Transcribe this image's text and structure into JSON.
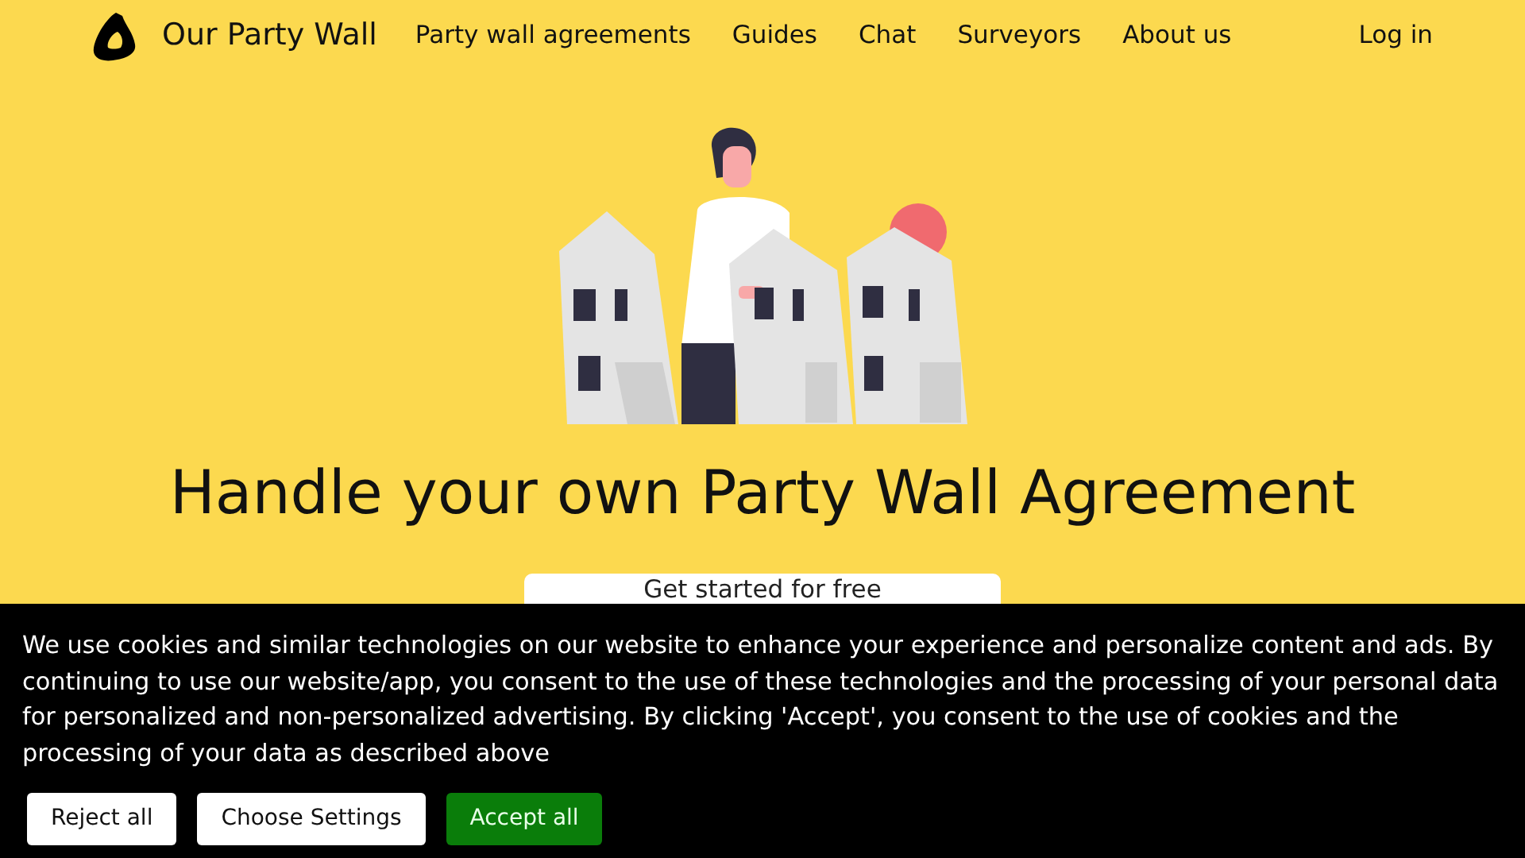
{
  "header": {
    "brand": "Our Party Wall",
    "nav": [
      "Party wall agreements",
      "Guides",
      "Chat",
      "Surveyors",
      "About us"
    ],
    "login": "Log in"
  },
  "hero": {
    "title": "Handle your own Party Wall Agreement",
    "cta": "Get started for free"
  },
  "cookie_banner": {
    "text": "We use cookies and similar technologies on our website to enhance your experience and personalize content and ads. By continuing to use our website/app, you consent to the use of these technologies and the processing of your personal data for personalized and non-personalized advertising. By clicking 'Accept', you consent to the use of cookies and the processing of your data as described above",
    "buttons": [
      {
        "label": "Reject all",
        "kind": "secondary"
      },
      {
        "label": "Choose Settings",
        "kind": "secondary"
      },
      {
        "label": "Accept all",
        "kind": "primary"
      }
    ]
  }
}
